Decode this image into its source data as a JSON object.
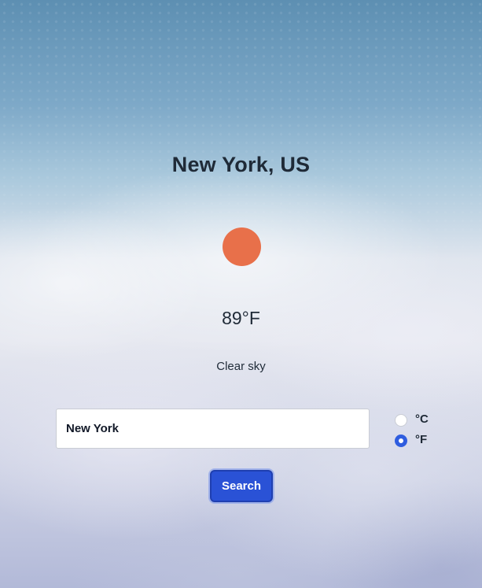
{
  "weather": {
    "location": "New York, US",
    "temperature": "89°F",
    "condition": "Clear sky",
    "icon": "sun-icon",
    "icon_color": "#e8704a"
  },
  "search": {
    "value": "New York",
    "button_label": "Search",
    "button_color": "#2a52d6"
  },
  "units": {
    "celsius_label": "°C",
    "fahrenheit_label": "°F",
    "selected": "°F"
  }
}
